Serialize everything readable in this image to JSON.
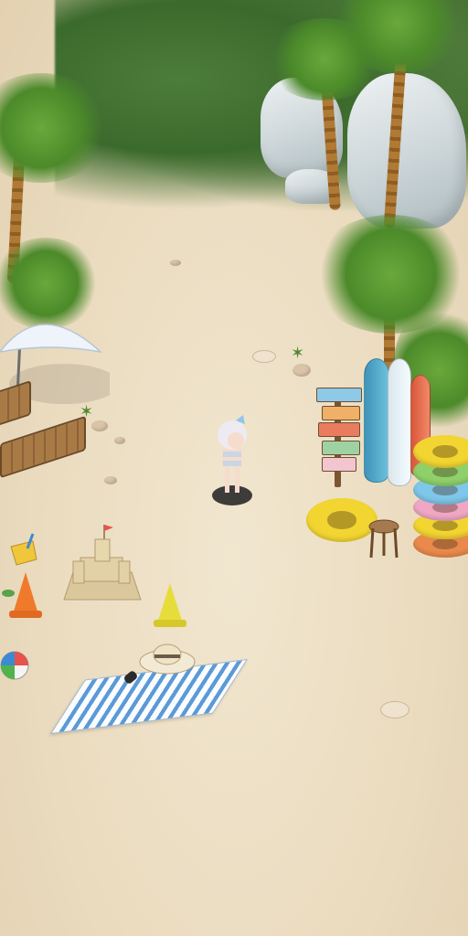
{
  "scene": {
    "type": "isometric-beach-map",
    "ground_color": "#ebdcc0",
    "foliage_color": "#4c8a2a",
    "rock_color": "#d6dde0"
  },
  "player": {
    "icon": "character-sprite",
    "hair_color": "#e9e6ef",
    "ribbon_color": "#8fc6ec"
  },
  "objects": {
    "umbrella_color": "#eef4fa",
    "towel_colors": [
      "#ffffff",
      "#5b9ad6"
    ],
    "cone_colors": [
      "#f07a2c",
      "#e6dd3a"
    ],
    "float_colors": [
      "#f3d531",
      "#8fd06a",
      "#7ec7e8",
      "#f0a7c4",
      "#e98a4c"
    ],
    "surfboard_colors": [
      "#4aa3c8",
      "#e8f1f5",
      "#e86a4a"
    ],
    "signpost_board_colors": [
      "#8ec9e8",
      "#f0b067",
      "#e97c5e",
      "#9fd2a2",
      "#f3c5cf"
    ]
  }
}
